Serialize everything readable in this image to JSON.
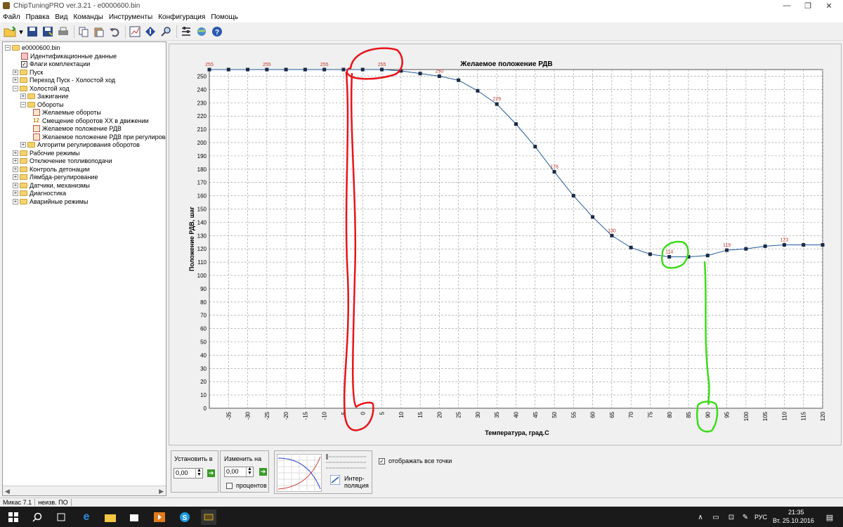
{
  "window": {
    "title": "ChipTuningPRO ver.3.21 - e0000600.bin"
  },
  "menu": [
    "Файл",
    "Правка",
    "Вид",
    "Команды",
    "Инструменты",
    "Конфигурация",
    "Помощь"
  ],
  "tree": {
    "root": "e0000600.bin",
    "items": [
      {
        "label": "Идентификационные данные",
        "level": 1,
        "kind": "leaf-red"
      },
      {
        "label": "Флаги комплектации",
        "level": 1,
        "kind": "checkbox"
      },
      {
        "label": "Пуск",
        "level": 1,
        "kind": "folder",
        "expander": "+"
      },
      {
        "label": "Переход Пуск - Холостой ход",
        "level": 1,
        "kind": "folder",
        "expander": "+"
      },
      {
        "label": "Холостой ход",
        "level": 1,
        "kind": "folder",
        "expander": "-"
      },
      {
        "label": "Зажигание",
        "level": 2,
        "kind": "folder",
        "expander": "+"
      },
      {
        "label": "Обороты",
        "level": 2,
        "kind": "folder",
        "expander": "-"
      },
      {
        "label": "Желаемые обороты",
        "level": 3,
        "kind": "leaf"
      },
      {
        "label": "Смещение оборотов ХХ в движении",
        "level": 3,
        "kind": "leaf12"
      },
      {
        "label": "Желаемое положение РДВ",
        "level": 3,
        "kind": "leaf"
      },
      {
        "label": "Желаемое положение РДВ при регулирован",
        "level": 3,
        "kind": "leaf"
      },
      {
        "label": "Алгоритм регулирования оборотов",
        "level": 2,
        "kind": "folder",
        "expander": "+"
      },
      {
        "label": "Рабочие режимы",
        "level": 1,
        "kind": "folder",
        "expander": "+"
      },
      {
        "label": "Отключение топливоподачи",
        "level": 1,
        "kind": "folder",
        "expander": "+"
      },
      {
        "label": "Контроль детонации",
        "level": 1,
        "kind": "folder",
        "expander": "+"
      },
      {
        "label": "Лямбда-регулирование",
        "level": 1,
        "kind": "folder",
        "expander": "+"
      },
      {
        "label": "Датчики, механизмы",
        "level": 1,
        "kind": "folder",
        "expander": "+"
      },
      {
        "label": "Диагностика",
        "level": 1,
        "kind": "folder",
        "expander": "+"
      },
      {
        "label": "Аварийные режимы",
        "level": 1,
        "kind": "folder",
        "expander": "+"
      }
    ]
  },
  "chart_data": {
    "type": "line",
    "title": "Желаемое положение РДВ",
    "xlabel": "Температура, град.С",
    "ylabel": "Положение РДВ, шаг",
    "x": [
      -40,
      -35,
      -30,
      -25,
      -20,
      -15,
      -10,
      -5,
      0,
      5,
      10,
      15,
      20,
      25,
      30,
      35,
      40,
      45,
      50,
      55,
      60,
      65,
      70,
      75,
      80,
      85,
      90,
      95,
      100,
      105,
      110,
      115,
      120
    ],
    "values": [
      255,
      255,
      255,
      255,
      255,
      255,
      255,
      255,
      255,
      255,
      254,
      252,
      250,
      247,
      239,
      229,
      214,
      197,
      178,
      160,
      144,
      130,
      121,
      116,
      114,
      114,
      115,
      119,
      120,
      122,
      123,
      123,
      123
    ],
    "point_labels": [
      {
        "x": -40,
        "text": "255"
      },
      {
        "x": -25,
        "text": "255"
      },
      {
        "x": -10,
        "text": "255"
      },
      {
        "x": 5,
        "text": "255"
      },
      {
        "x": 20,
        "text": "250"
      },
      {
        "x": 35,
        "text": "229"
      },
      {
        "x": 50,
        "text": "178"
      },
      {
        "x": 65,
        "text": "130"
      },
      {
        "x": 80,
        "text": "114"
      },
      {
        "x": 95,
        "text": "119"
      },
      {
        "x": 110,
        "text": "123"
      }
    ],
    "xticks": [
      -35,
      -30,
      -25,
      -20,
      -15,
      -10,
      -5,
      0,
      5,
      10,
      15,
      20,
      25,
      30,
      35,
      40,
      45,
      50,
      55,
      60,
      65,
      70,
      75,
      80,
      85,
      90,
      95,
      100,
      105,
      110,
      115,
      120
    ],
    "yticks": [
      0,
      10,
      20,
      30,
      40,
      50,
      60,
      70,
      80,
      90,
      100,
      110,
      120,
      130,
      140,
      150,
      160,
      170,
      180,
      190,
      200,
      210,
      220,
      230,
      240,
      250
    ],
    "xlim": [
      -40,
      120
    ],
    "ylim": [
      0,
      255
    ],
    "grid": true,
    "line_color": "#1f5a9a",
    "marker_color": "#1a2a44",
    "label_color": "#c0392b"
  },
  "controls": {
    "set_label": "Установить в",
    "set_value": "0,00",
    "change_label": "Изменить на",
    "change_value": "0,00",
    "percent_label": "процентов",
    "interp_label_1": "Интер-",
    "interp_label_2": "поляция",
    "show_points_label": "отображать все точки",
    "show_points_checked": "✓"
  },
  "status": {
    "left": "Микас 7.1",
    "right": "неизв. ПО"
  },
  "taskbar": {
    "lang": "РУС",
    "time": "21:35",
    "date": "Вт. 25.10.2016"
  },
  "colors": {
    "annotation_red": "#e8141c",
    "annotation_green": "#3ddc1a"
  }
}
